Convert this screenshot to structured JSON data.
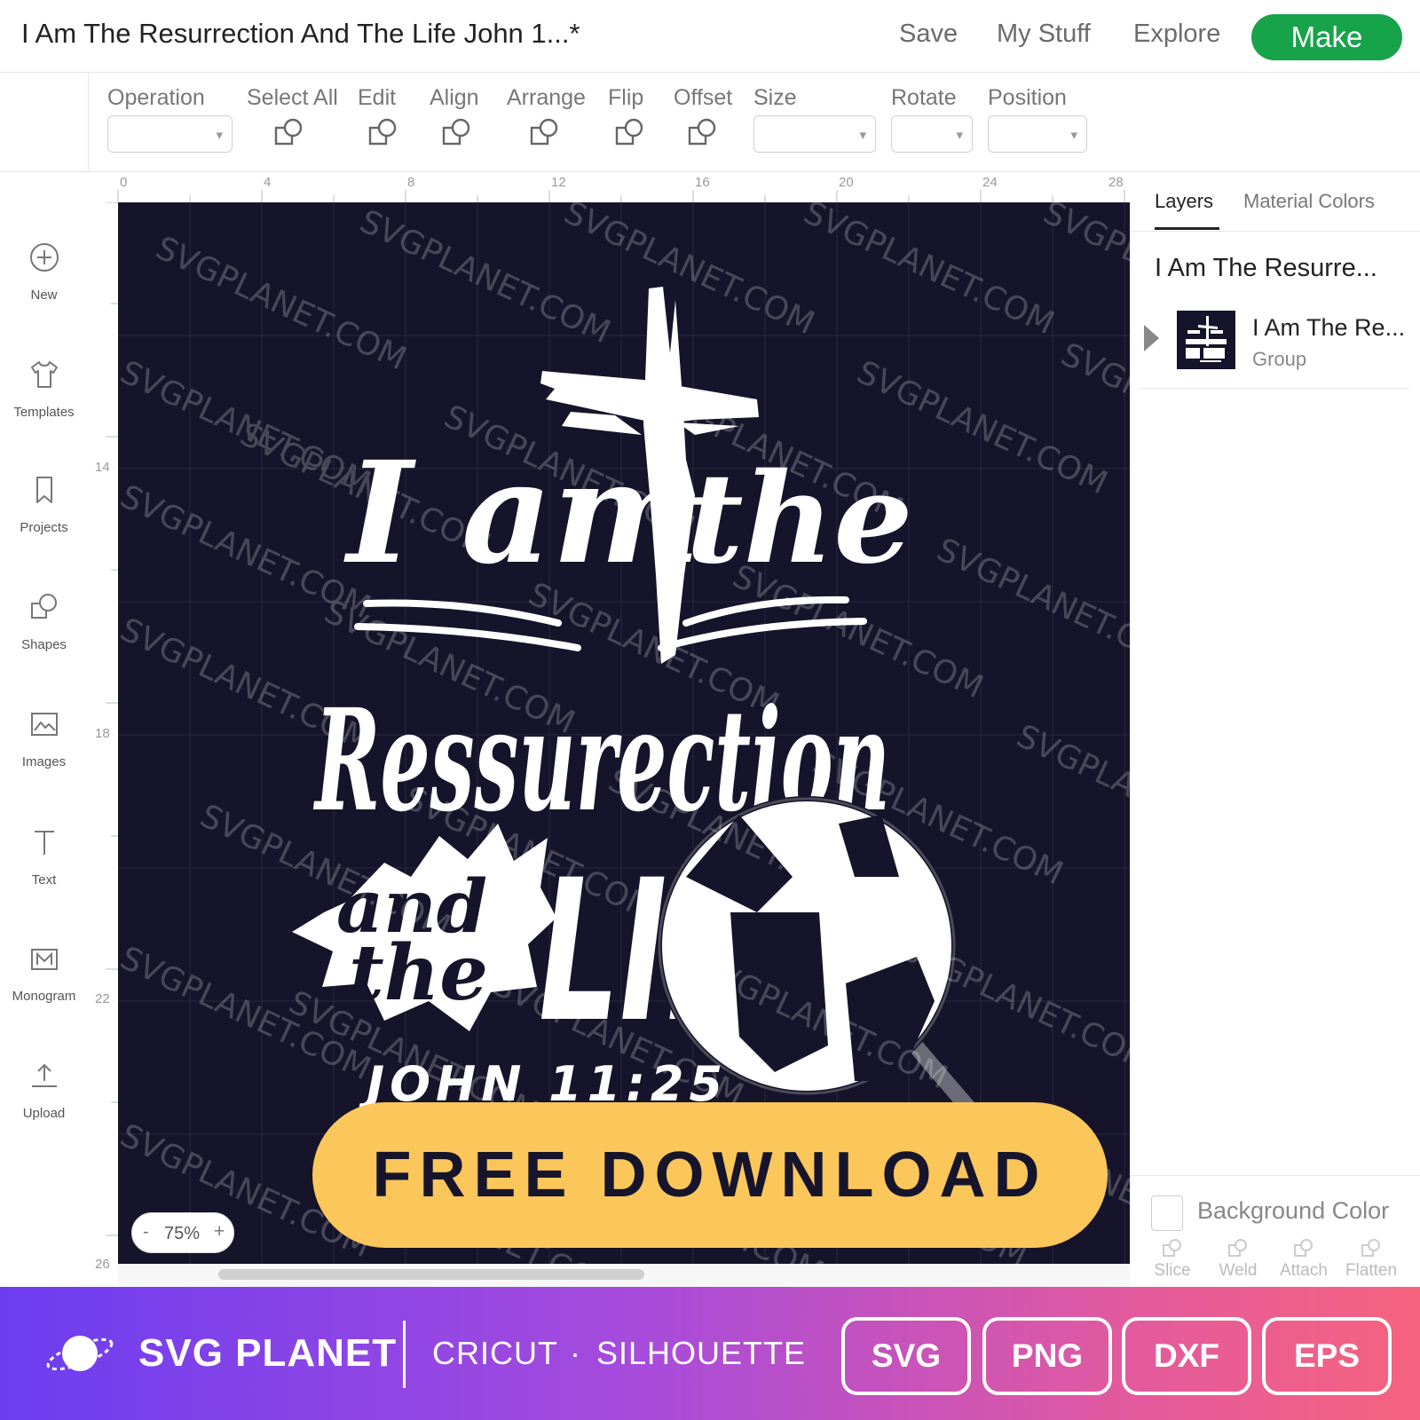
{
  "header": {
    "title": "I Am The Resurrection And The Life John 1...*",
    "nav": [
      "Save",
      "My Stuff",
      "Explore"
    ],
    "make_label": "Make",
    "make_color": "#16a34a"
  },
  "toolbar": {
    "operation": "Operation",
    "select_all": "Select All",
    "edit": "Edit",
    "align": "Align",
    "arrange": "Arrange",
    "flip": "Flip",
    "offset": "Offset",
    "size": "Size",
    "rotate": "Rotate",
    "position": "Position",
    "caret": "▾"
  },
  "sidebar": {
    "items": [
      {
        "label": "New",
        "icon": "plus-circle-icon"
      },
      {
        "label": "Templates",
        "icon": "shirt-icon"
      },
      {
        "label": "Projects",
        "icon": "bookmark-icon"
      },
      {
        "label": "Shapes",
        "icon": "shapes-icon"
      },
      {
        "label": "Images",
        "icon": "image-icon"
      },
      {
        "label": "Text",
        "icon": "text-icon"
      },
      {
        "label": "Monogram",
        "icon": "monogram-icon"
      },
      {
        "label": "Upload",
        "icon": "upload-icon"
      }
    ]
  },
  "canvas": {
    "ruler_top": [
      "0",
      "4",
      "8",
      "12",
      "16",
      "20",
      "24",
      "28"
    ],
    "ruler_left": [
      "14",
      "18",
      "22",
      "26"
    ],
    "watermark": "SVGPLANET.COM",
    "design_background": "#15142a",
    "design_text": {
      "line1a": "I am",
      "line1b": "the",
      "line2": "Ressurection",
      "and": "and",
      "the": "the",
      "life": "LIFE",
      "ref": "JOHN 11:25"
    },
    "cta": "FREE DOWNLOAD",
    "cta_color": "#fbc65a",
    "zoom": {
      "minus": "-",
      "value": "75%",
      "plus": "+"
    }
  },
  "right_panel": {
    "tabs": [
      "Layers",
      "Material Colors"
    ],
    "doc_name": "I Am The Resurre...",
    "layer": {
      "name": "I Am The Re...",
      "type": "Group"
    },
    "background_color_label": "Background Color",
    "actions": [
      "Slice",
      "Weld",
      "Attach",
      "Flatten"
    ]
  },
  "banner": {
    "brand": "SVG PLANET",
    "platforms": [
      "CRICUT",
      "SILHOUETTE"
    ],
    "separator": "·",
    "formats": [
      "SVG",
      "PNG",
      "DXF",
      "EPS"
    ],
    "gradient": [
      "#6c3df0",
      "#f6637e"
    ]
  }
}
